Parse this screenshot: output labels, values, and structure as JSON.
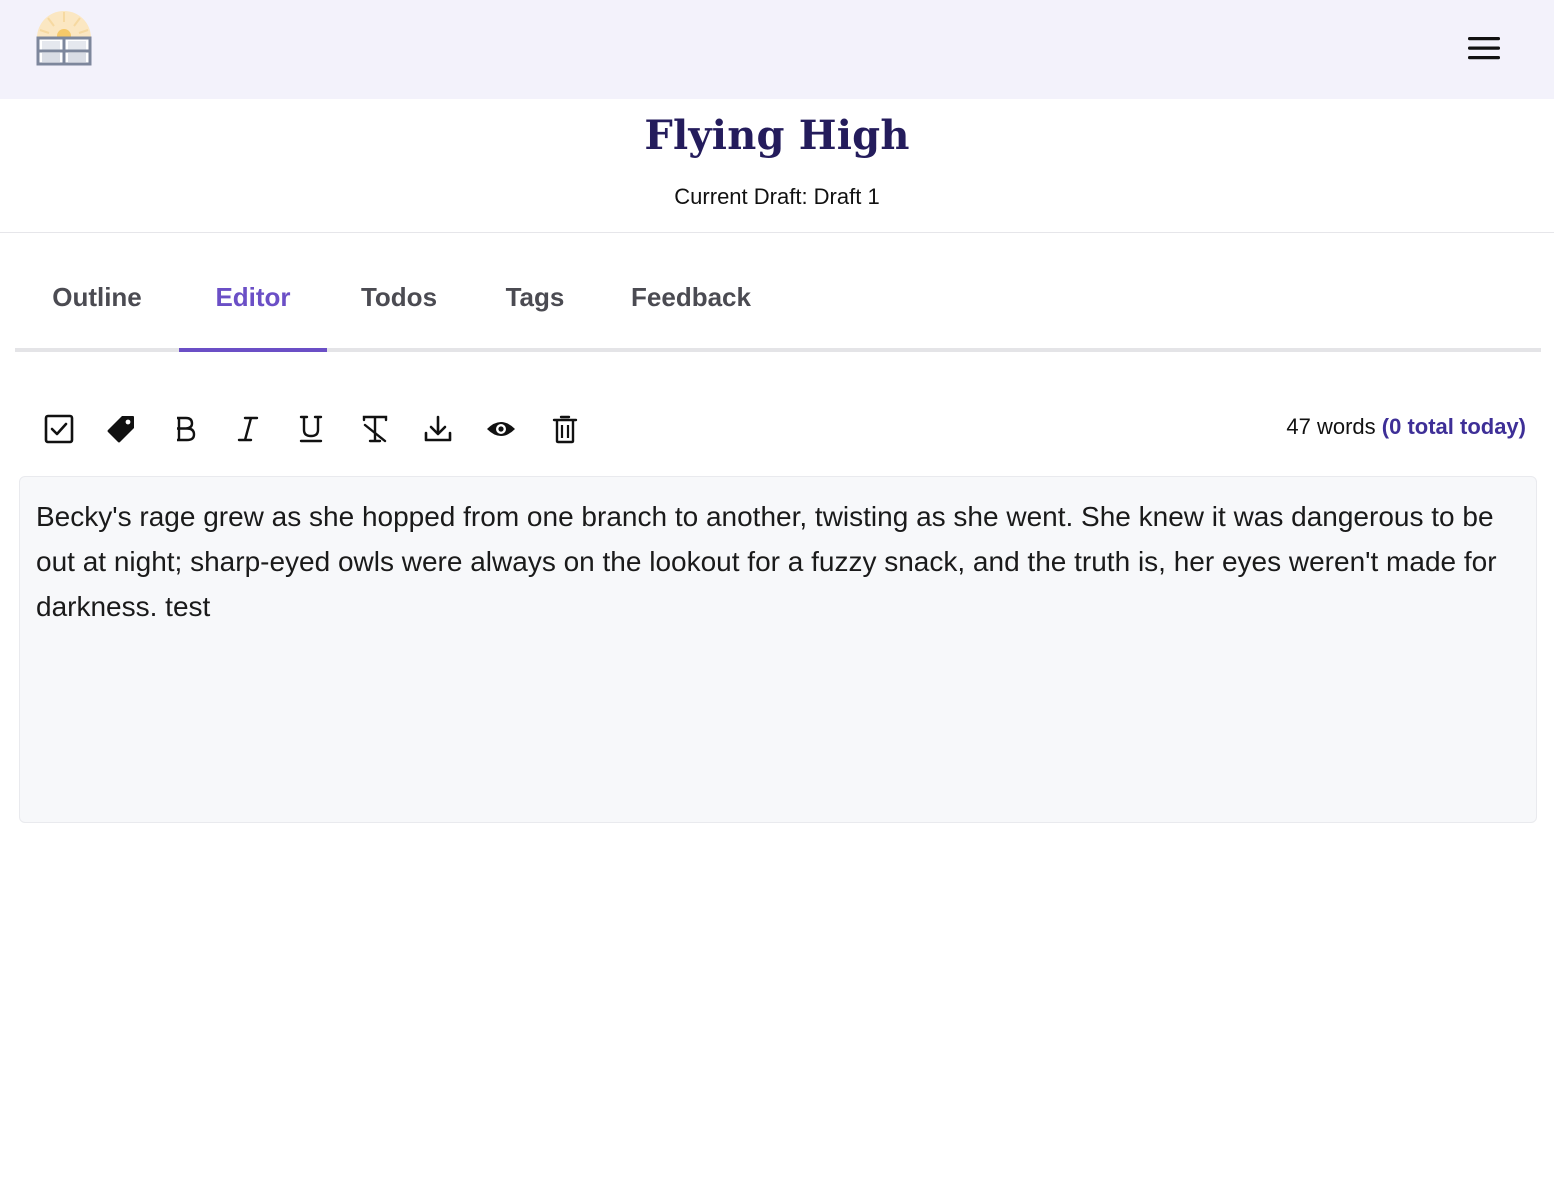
{
  "app": {
    "logo_icon": "sunrise-building-logo",
    "menu_icon": "hamburger-menu-icon"
  },
  "project": {
    "title": "Flying High",
    "current_draft": "Current Draft: Draft 1"
  },
  "tabs": [
    {
      "label": "Outline",
      "active": false
    },
    {
      "label": "Editor",
      "active": true
    },
    {
      "label": "Todos",
      "active": false
    },
    {
      "label": "Tags",
      "active": false
    },
    {
      "label": "Feedback",
      "active": false
    }
  ],
  "toolbar": {
    "tools": [
      {
        "icon": "checkbox-icon",
        "action": "todo"
      },
      {
        "icon": "tag-icon",
        "action": "tag"
      },
      {
        "icon": "bold-icon",
        "action": "bold"
      },
      {
        "icon": "italic-icon",
        "action": "italic"
      },
      {
        "icon": "underline-icon",
        "action": "underline"
      },
      {
        "icon": "clear-format-icon",
        "action": "clear formatting"
      },
      {
        "icon": "download-icon",
        "action": "download"
      },
      {
        "icon": "eye-icon",
        "action": "preview"
      },
      {
        "icon": "trash-icon",
        "action": "delete"
      }
    ],
    "word_count": "47 words",
    "today_total": "(0 total today)"
  },
  "editor": {
    "text": "Becky's rage grew as she hopped from one branch to another, twisting as she went. She knew it was dangerous to be out at night; sharp-eyed owls were always on the lookout for a fuzzy snack, and the truth is, her eyes weren't made for darkness. test"
  },
  "colors": {
    "accent": "#6b4fc6",
    "title": "#241c5c",
    "topbar": "#f3f2fb",
    "today_count": "#3e2f97"
  }
}
